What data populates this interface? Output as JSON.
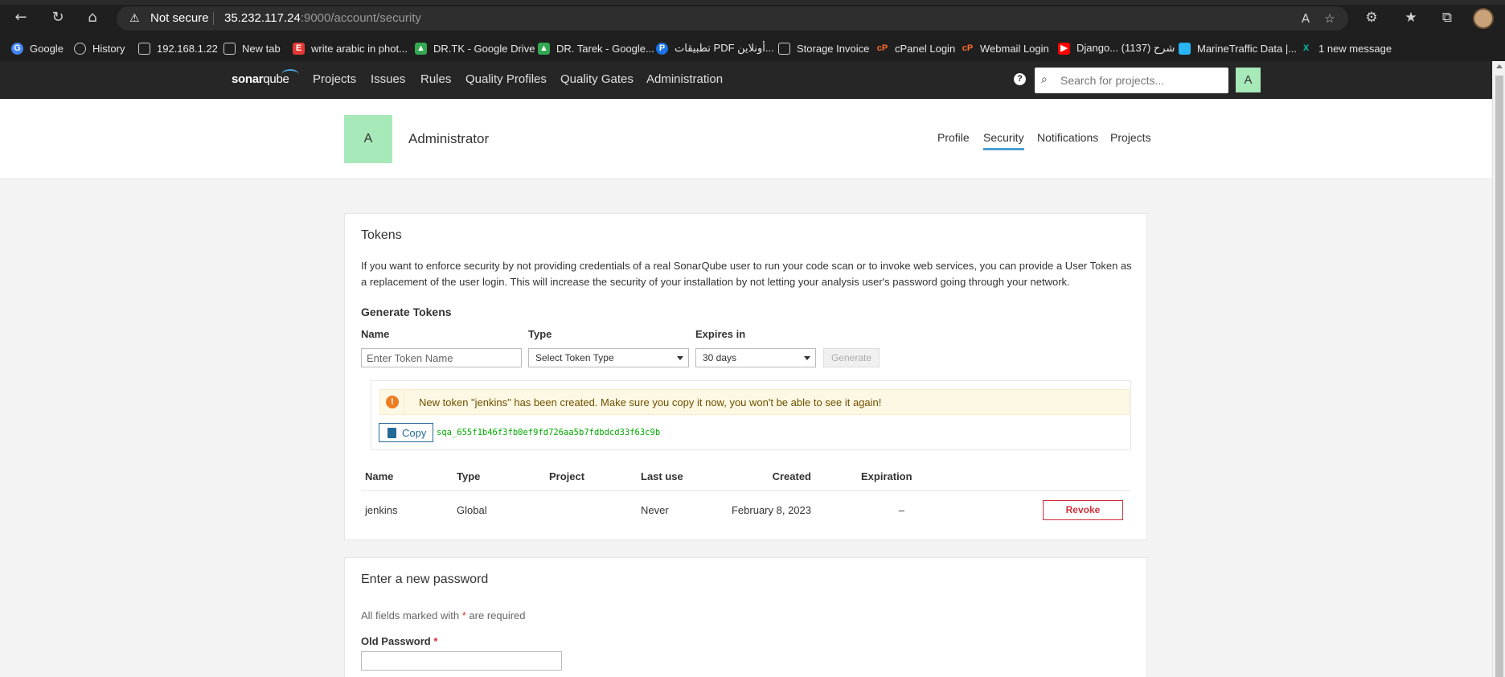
{
  "browser": {
    "security_label": "Not secure",
    "url_host": "35.232.117.24",
    "url_rest": ":9000/account/security",
    "bookmarks": [
      {
        "label": "Google",
        "color": "#4285f4",
        "icon": "google-icon"
      },
      {
        "label": "History",
        "color": "#555555",
        "icon": "history-icon"
      },
      {
        "label": "192.168.1.22",
        "color": "#555555",
        "icon": "page-icon"
      },
      {
        "label": "New tab",
        "color": "#555555",
        "icon": "newtab-icon"
      },
      {
        "label": "write arabic in phot...",
        "color": "#e53935",
        "icon": "e-icon"
      },
      {
        "label": "DR.TK - Google Drive",
        "color": "#34a853",
        "icon": "drive-icon"
      },
      {
        "label": "DR. Tarek - Google...",
        "color": "#34a853",
        "icon": "drive-icon"
      },
      {
        "label": "تطبيقات PDF أونلاين...",
        "color": "#1a73e8",
        "icon": "p-icon"
      },
      {
        "label": "Storage Invoice",
        "color": "#555555",
        "icon": "page-icon"
      },
      {
        "label": "cPanel Login",
        "color": "#ff6c2c",
        "icon": "cpanel-icon"
      },
      {
        "label": "Webmail Login",
        "color": "#ff6c2c",
        "icon": "cpanel-icon"
      },
      {
        "label": "Django... شرح (1137)",
        "color": "#ff0000",
        "icon": "youtube-icon"
      },
      {
        "label": "MarineTraffic Data |...",
        "color": "#29b6f6",
        "icon": "marine-icon"
      },
      {
        "label": "1 new message",
        "color": "#00bfa5",
        "icon": "message-icon"
      }
    ]
  },
  "nav": {
    "logo_bold": "sonar",
    "logo_light": "qube",
    "items": [
      "Projects",
      "Issues",
      "Rules",
      "Quality Profiles",
      "Quality Gates",
      "Administration"
    ],
    "help": "?",
    "search_placeholder": "Search for projects...",
    "avatar_letter": "A"
  },
  "account": {
    "avatar_letter": "A",
    "name": "Administrator",
    "tabs": [
      "Profile",
      "Security",
      "Notifications",
      "Projects"
    ],
    "active_tab": "Security"
  },
  "tokens": {
    "title": "Tokens",
    "description": "If you want to enforce security by not providing credentials of a real SonarQube user to run your code scan or to invoke web services, you can provide a User Token as a replacement of the user login. This will increase the security of your installation by not letting your analysis user's password going through your network.",
    "generate_title": "Generate Tokens",
    "name_label": "Name",
    "name_placeholder": "Enter Token Name",
    "type_label": "Type",
    "type_value": "Select Token Type",
    "expires_label": "Expires in",
    "expires_value": "30 days",
    "generate_button": "Generate",
    "alert_icon": "!",
    "alert_text": "New token \"jenkins\" has been created. Make sure you copy it now, you won't be able to see it again!",
    "copy_button": "Copy",
    "token_value": "sqa_655f1b46f3fb0ef9fd726aa5b7fdbdcd33f63c9b",
    "columns": [
      "Name",
      "Type",
      "Project",
      "Last use",
      "Created",
      "Expiration"
    ],
    "rows": [
      {
        "name": "jenkins",
        "type": "Global",
        "project": "",
        "last_use": "Never",
        "created": "February 8, 2023",
        "expiration": "–",
        "action": "Revoke"
      }
    ]
  },
  "password": {
    "title": "Enter a new password",
    "required_note": "All fields marked with",
    "required_star": "*",
    "required_suffix": "are required",
    "old_password_label": "Old Password",
    "old_password_star": "*"
  },
  "colors": {
    "accent": "#4b9fd5",
    "avatar_bg": "#a7e9b8",
    "danger": "#d02f3a",
    "token_green": "#00aa00",
    "alert_bg": "#fcf8e3"
  }
}
